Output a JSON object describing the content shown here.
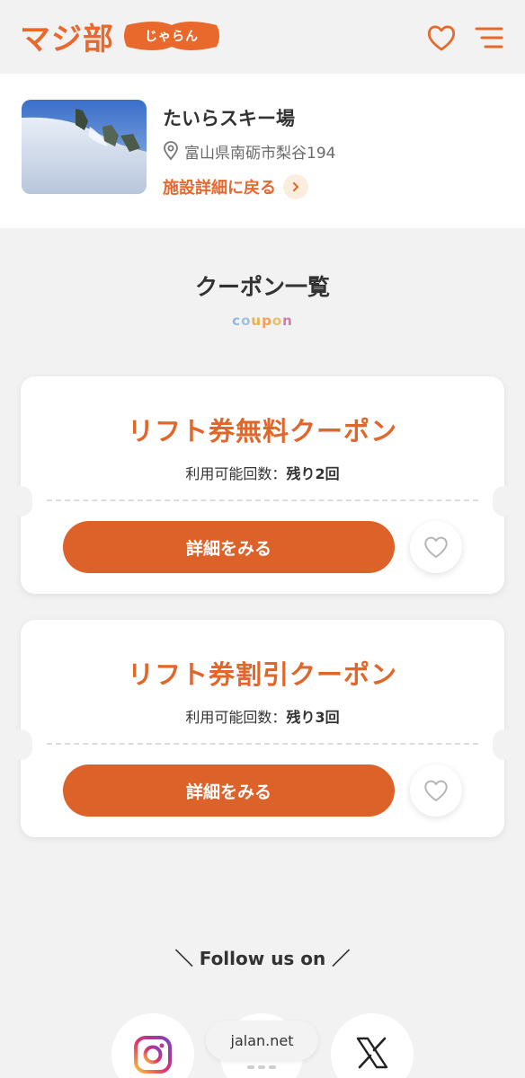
{
  "header": {
    "logo_text": "マジ部",
    "logo_pill_text": "じゃらん",
    "brand_color": "#e8692b",
    "favorite_icon": "heart-icon",
    "menu_icon": "hamburger-menu-icon"
  },
  "facility": {
    "name": "たいらスキー場",
    "address": "富山県南砺市梨谷194",
    "back_label": "施設詳細に戻る",
    "location_icon": "location-pin-icon",
    "back_icon": "chevron-right-icon"
  },
  "section": {
    "title": "クーポン一覧",
    "subtitle_letters": [
      {
        "ch": "c",
        "color": "#8fb8e6"
      },
      {
        "ch": "o",
        "color": "#9fc0e0"
      },
      {
        "ch": "u",
        "color": "#e9b24a"
      },
      {
        "ch": "p",
        "color": "#f0a05a"
      },
      {
        "ch": "o",
        "color": "#e9c066"
      },
      {
        "ch": "n",
        "color": "#d97aa8"
      }
    ]
  },
  "coupons": [
    {
      "title": "リフト券無料クーポン",
      "uses_label": "利用可能回数：",
      "uses_value": "残り2回",
      "button_label": "詳細をみる"
    },
    {
      "title": "リフト券割引クーポン",
      "uses_label": "利用可能回数：",
      "uses_value": "残り3回",
      "button_label": "詳細をみる"
    }
  ],
  "footer": {
    "follow_label": "＼ Follow us on ／",
    "social": [
      "instagram-icon",
      "other-sns-icon",
      "x-icon"
    ],
    "url_overlay": "jalan.net"
  },
  "colors": {
    "accent": "#dc6229",
    "background": "#f2f2f2"
  }
}
